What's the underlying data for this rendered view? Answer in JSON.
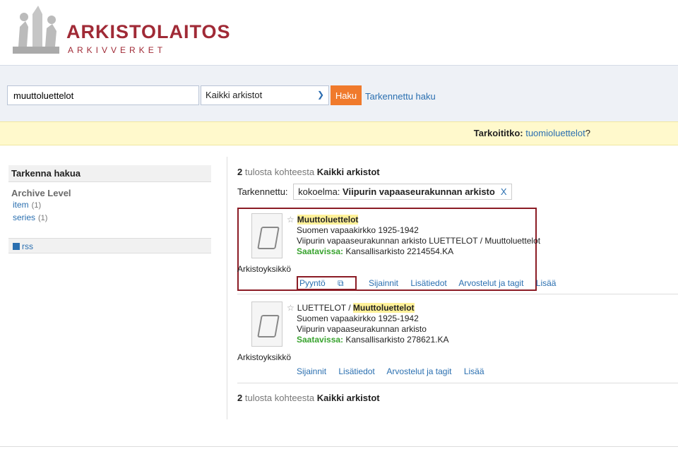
{
  "header": {
    "logo_title": "ARKISTOLAITOS",
    "logo_sub": "ARKIVVERKET"
  },
  "search": {
    "query": "muuttoluettelot",
    "scope": "Kaikki arkistot",
    "button": "Haku",
    "advanced": "Tarkennettu haku"
  },
  "suggest": {
    "prefix": "Tarkoititko: ",
    "term": "tuomioluettelot",
    "suffix": "?"
  },
  "sidebar": {
    "title": "Tarkenna hakua",
    "facet": "Archive Level",
    "items": [
      {
        "label": "item",
        "count": "(1)"
      },
      {
        "label": "series",
        "count": "(1)"
      }
    ],
    "rss": "rss"
  },
  "results": {
    "count_prefix": "2",
    "count_mid": " tulosta kohteesta ",
    "count_scope": "Kaikki arkistot",
    "filter_label": "Tarkennettu:",
    "filter_key": "kokoelma: ",
    "filter_value": "Viipurin vapaaseurakunnan arkisto",
    "filter_remove": "X",
    "items": [
      {
        "format": "Arkistoyksikkö",
        "title_prefix": "",
        "title_hl": "Muuttoluettelot",
        "line1": "Suomen vapaakirkko 1925-1942",
        "line2": "Viipurin vapaaseurakunnan arkisto LUETTELOT / Muuttoluettelot",
        "avail_label": "Saatavissa:",
        "avail_value": " Kansallisarkisto  2214554.KA",
        "links": [
          "Pyyntö",
          "Sijainnit",
          "Lisätiedot",
          "Arvostelut ja tagit",
          "Lisää"
        ]
      },
      {
        "format": "Arkistoyksikkö",
        "title_prefix": "LUETTELOT / ",
        "title_hl": "Muuttoluettelot",
        "line1": "Suomen vapaakirkko 1925-1942",
        "line2": "Viipurin vapaaseurakunnan arkisto",
        "avail_label": "Saatavissa:",
        "avail_value": " Kansallisarkisto  278621.KA",
        "links": [
          "Sijainnit",
          "Lisätiedot",
          "Arvostelut ja tagit",
          "Lisää"
        ]
      }
    ]
  }
}
